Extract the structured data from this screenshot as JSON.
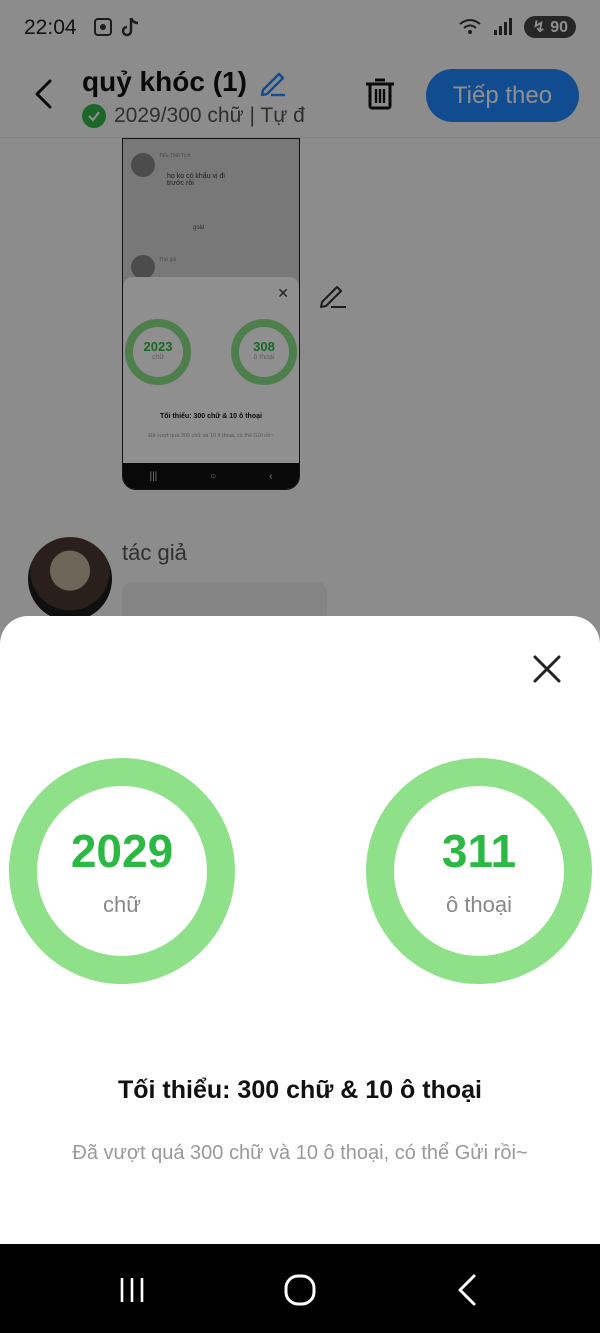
{
  "status_bar": {
    "time": "22:04",
    "battery": "90",
    "icons_left": [
      "screenshot-icon",
      "tiktok-icon"
    ],
    "icons_right": [
      "wifi-icon",
      "signal-icon",
      "battery-icon"
    ]
  },
  "header": {
    "title": "quỷ khóc (1)",
    "subtitle": "2029/300 chữ | Tự đ",
    "next_label": "Tiếp theo",
    "accent_color": "#1e88ff"
  },
  "preview": {
    "sender_name": "Tiểu Thất Tịch",
    "message": "họ ko có khẩu vị đi trước rồi",
    "reply": "gold",
    "sender2_name": "Thử giả",
    "words_value": "2023",
    "words_label": "chữ",
    "dialogs_value": "308",
    "dialogs_label": "ô thoại",
    "minimum": "Tối thiểu: 300 chữ & 10 ô thoại",
    "note": "Đã vượt quá 300 chữ và 10 ô thoại, có thể Gửi rồi~"
  },
  "author": {
    "name": "tác giả"
  },
  "sheet": {
    "words_value": "2029",
    "words_label": "chữ",
    "dialogs_value": "311",
    "dialogs_label": "ô thoại",
    "minimum": "Tối thiểu: 300 chữ & 10 ô thoại",
    "note": "Đã vượt quá 300 chữ và 10 ô thoại, có thể Gửi rồi~",
    "ring_color": "#8ee089",
    "value_color": "#2bb943"
  },
  "nav_bar": {
    "buttons": [
      "recents-icon",
      "home-icon",
      "back-icon"
    ]
  }
}
